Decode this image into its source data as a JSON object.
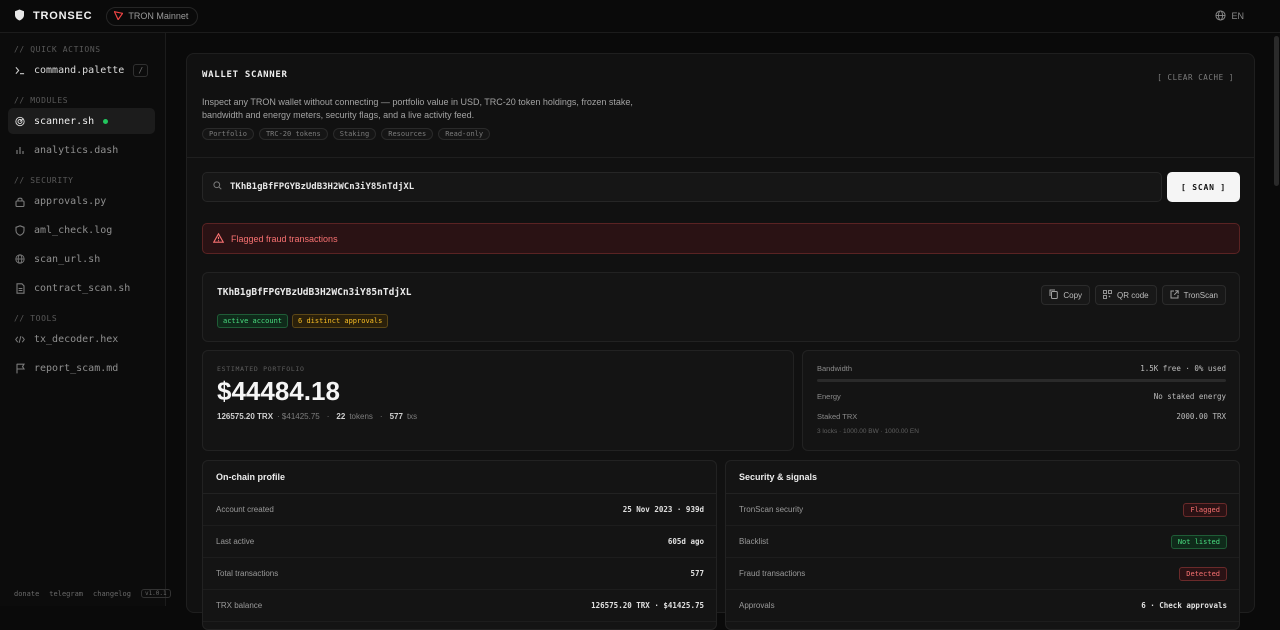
{
  "topbar": {
    "brand": "TRONSEC",
    "network": "TRON Mainnet",
    "language": "EN"
  },
  "sidebar": {
    "sections": [
      {
        "label": "// QUICK ACTIONS",
        "items": [
          {
            "label": "command.palette",
            "shortcut": "/",
            "icon": "terminal-icon"
          }
        ]
      },
      {
        "label": "// MODULES",
        "items": [
          {
            "label": "scanner.sh",
            "icon": "radar-icon",
            "active": true
          },
          {
            "label": "analytics.dash",
            "icon": "bar-chart-icon"
          }
        ]
      },
      {
        "label": "// SECURITY",
        "items": [
          {
            "label": "approvals.py",
            "icon": "lock-icon"
          },
          {
            "label": "aml_check.log",
            "icon": "shield-icon"
          },
          {
            "label": "scan_url.sh",
            "icon": "globe-icon"
          },
          {
            "label": "contract_scan.sh",
            "icon": "file-icon"
          }
        ]
      },
      {
        "label": "// TOOLS",
        "items": [
          {
            "label": "tx_decoder.hex",
            "icon": "code-icon"
          },
          {
            "label": "report_scam.md",
            "icon": "flag-icon"
          }
        ]
      }
    ],
    "footer": {
      "donate": "donate",
      "telegram": "telegram",
      "changelog": "changelog",
      "version": "v1.0.1"
    }
  },
  "scanner": {
    "title": "WALLET SCANNER",
    "clear_cache": "[ CLEAR CACHE ]",
    "description": "Inspect any TRON wallet without connecting — portfolio value in USD, TRC-20 token holdings, frozen stake, bandwidth and energy meters, security flags, and a live activity feed.",
    "tags": [
      "Portfolio",
      "TRC-20 tokens",
      "Staking",
      "Resources",
      "Read-only"
    ],
    "search_value": "TKhB1gBfFPGYBzUdB3H2WCn3iY85nTdjXL",
    "scan_label": "[ SCAN ]",
    "alert": "Flagged fraud transactions"
  },
  "wallet": {
    "address": "TKhB1gBfFPGYBzUdB3H2WCn3iY85nTdjXL",
    "badges": [
      "active account",
      "6 distinct approvals"
    ],
    "actions": [
      "Copy",
      "QR code",
      "TronScan"
    ]
  },
  "portfolio": {
    "label": "ESTIMATED PORTFOLIO",
    "value": "$44484.18",
    "trx": "126575.20 TRX",
    "trx_usd": "· $41425.75",
    "tokens_count": "22",
    "tokens_label": "tokens",
    "txs_count": "577",
    "txs_label": "txs"
  },
  "resources": {
    "bandwidth_label": "Bandwidth",
    "bandwidth_value": "1.5K free · 0% used",
    "bandwidth_used_fraction": 0,
    "energy_label": "Energy",
    "energy_value": "No staked energy",
    "staked_label": "Staked TRX",
    "staked_value": "2000.00 TRX",
    "staked_detail": "3 locks · 1000.00 BW · 1000.00 EN"
  },
  "profile": {
    "title": "On-chain profile",
    "rows": [
      {
        "label": "Account created",
        "value": "25 Nov 2023 · 939d"
      },
      {
        "label": "Last active",
        "value": "605d ago"
      },
      {
        "label": "Total transactions",
        "value": "577"
      },
      {
        "label": "TRX balance",
        "value": "126575.20 TRX · $41425.75"
      }
    ]
  },
  "security": {
    "title": "Security & signals",
    "rows": [
      {
        "label": "TronScan security",
        "value": "Flagged",
        "tone": "red"
      },
      {
        "label": "Blacklist",
        "value": "Not listed",
        "tone": "green"
      },
      {
        "label": "Fraud transactions",
        "value": "Detected",
        "tone": "red"
      },
      {
        "label": "Approvals",
        "value": "6 · Check approvals",
        "tone": "plain"
      }
    ]
  },
  "colors": {
    "accent_green": "#22c55e",
    "alert_red": "#f87171",
    "tron_red": "#ef4444"
  }
}
